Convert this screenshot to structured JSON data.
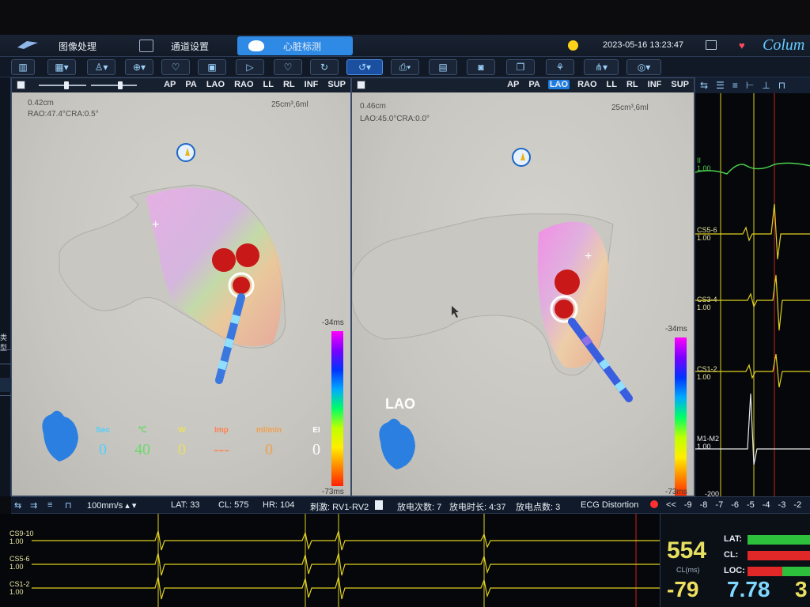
{
  "nav": {
    "tabs": [
      {
        "label": "图像处理"
      },
      {
        "label": "通道设置"
      },
      {
        "label": "心脏标测"
      }
    ],
    "datetime": "2023-05-16 13:23:47",
    "brand": "Colum"
  },
  "toolbar": {
    "icons": [
      "layout-icon",
      "grid-icon",
      "person-icon",
      "crosshair-icon",
      "heart-icon",
      "palette-icon",
      "play-icon",
      "pulse-icon",
      "loop-icon",
      "arc-icon",
      "print-icon",
      "device-icon",
      "camera-icon",
      "copy-icon",
      "lungs-icon",
      "signal-icon",
      "target-icon"
    ]
  },
  "left_strip": {
    "label": "类型"
  },
  "views": [
    "AP",
    "PA",
    "LAO",
    "RAO",
    "LL",
    "RL",
    "INF",
    "SUP"
  ],
  "left_view": {
    "distance": "0.42cm",
    "angle": "RAO:47.4°CRA:0.5°",
    "volume": "25cm³,6ml",
    "colorbar_top": "-34ms",
    "colorbar_bottom": "-73ms",
    "params": [
      {
        "label": "Sec",
        "value": "0",
        "color": "#4fd0ff"
      },
      {
        "label": "℃",
        "value": "40",
        "color": "#6dd86d"
      },
      {
        "label": "W",
        "value": "0",
        "color": "#e8e060"
      },
      {
        "label": "Imp",
        "value": "---",
        "color": "#ff8050"
      },
      {
        "label": "ml/min",
        "value": "0",
        "color": "#f0a050"
      },
      {
        "label": "EI",
        "value": "0",
        "color": "#ffffff"
      }
    ]
  },
  "right_view": {
    "distance": "0.46cm",
    "angle": "LAO:45.0°CRA:0.0°",
    "volume": "25cm³,6ml",
    "selected_view": "LAO",
    "view_name": "LAO",
    "colorbar_top": "-34ms",
    "colorbar_bottom": "-73ms"
  },
  "ecg_right": {
    "channels": [
      {
        "name": "II",
        "gain": "1.00"
      },
      {
        "name": "CS5-6",
        "gain": "1.00"
      },
      {
        "name": "CS3-4",
        "gain": "1.00"
      },
      {
        "name": "CS1-2",
        "gain": "1.00"
      },
      {
        "name": "M1-M2",
        "gain": "1.00"
      }
    ],
    "scale_bottom": "-200"
  },
  "status": {
    "speed": "100mm/s",
    "lat": "LAT: 33",
    "cl": "CL: 575",
    "hr": "HR: 104",
    "stim": "刺激: RV1-RV2",
    "discharge_count": "放电次数: 7",
    "discharge_time": "放电时长: 4:37",
    "discharge_points": "放电点数: 3",
    "ecg_distortion": "ECG Distortion",
    "scale": [
      "<<",
      "-9",
      "-8",
      "-7",
      "-6",
      "-5",
      "-4",
      "-3",
      "-2"
    ]
  },
  "ecg_bottom": {
    "channels": [
      {
        "name": "CS9-10",
        "gain": "1.00"
      },
      {
        "name": "CS5-6",
        "gain": "1.00"
      },
      {
        "name": "CS1-2",
        "gain": "1.00"
      }
    ]
  },
  "readout": {
    "cycle_value": "554",
    "cycle_unit": "CL(ms)",
    "lat_value": "-79",
    "main_value": "7.78",
    "extra_value": "3",
    "lat_label": "LAT:",
    "cl_label": "CL:",
    "loc_label": "LOC:"
  }
}
